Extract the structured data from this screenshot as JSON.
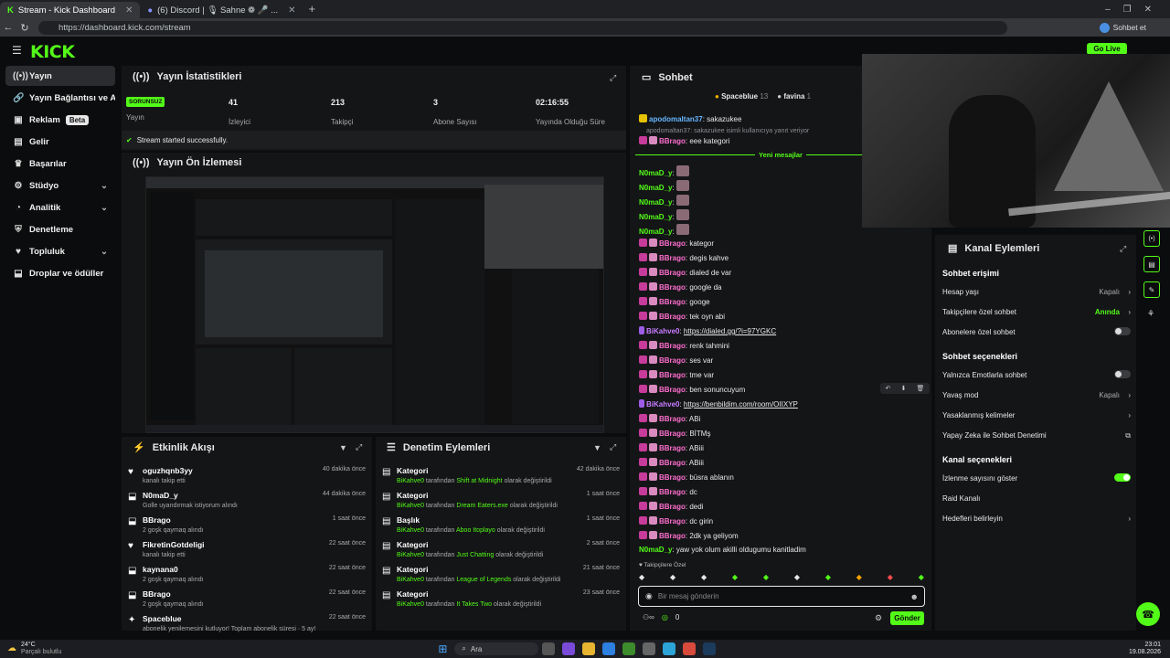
{
  "browser": {
    "tabs": [
      {
        "title": "Stream - Kick Dashboard"
      },
      {
        "title": "(6) Discord | 🎙 Sahne ❁ 🎤 ..."
      }
    ],
    "url": "https://dashboard.kick.com/stream",
    "profile_label": "Sohbet et"
  },
  "kick": {
    "logo": "KICK",
    "golive": "Go Live"
  },
  "sidebar": {
    "items": [
      {
        "label": "Yayın",
        "icon": "broadcast-icon"
      },
      {
        "label": "Yayın Bağlantısı ve Anahtarı",
        "icon": "link-icon"
      },
      {
        "label": "Reklam",
        "badge": "Beta",
        "icon": "ad-icon"
      },
      {
        "label": "Gelir",
        "icon": "money-icon"
      },
      {
        "label": "Başarılar",
        "icon": "trophy-icon"
      },
      {
        "label": "Stüdyo",
        "icon": "studio-icon"
      },
      {
        "label": "Analitik",
        "icon": "analytics-icon"
      },
      {
        "label": "Denetleme",
        "icon": "shield-icon"
      },
      {
        "label": "Topluluk",
        "icon": "community-icon"
      },
      {
        "label": "Droplar ve ödüller",
        "icon": "gift-icon"
      }
    ]
  },
  "stats": {
    "title": "Yayın İstatistikleri",
    "status_badge": "SORUNSUZ",
    "items": [
      {
        "value": "",
        "label": "Yayın"
      },
      {
        "value": "41",
        "label": "İzleyici"
      },
      {
        "value": "213",
        "label": "Takipçi"
      },
      {
        "value": "3",
        "label": "Abone Sayısı"
      },
      {
        "value": "02:16:55",
        "label": "Yayında Olduğu Süre"
      }
    ],
    "success": "Stream started successfully."
  },
  "preview": {
    "title": "Yayın Ön İzlemesi"
  },
  "activity": {
    "title": "Etkinlik Akışı",
    "items": [
      {
        "user": "oguzhqnb3yy",
        "desc": "kanalı takip etti",
        "time": "40 dakika önce",
        "icon": "heart-icon"
      },
      {
        "user": "N0maD_y",
        "desc": "Golle uyandırmak istiyorum alındı",
        "time": "44 dakika önce",
        "icon": "gift-icon"
      },
      {
        "user": "BBrago",
        "desc": "2 goşk qaymaq alındı",
        "time": "1 saat önce",
        "icon": "gift-icon"
      },
      {
        "user": "FikretinGotdeligi",
        "desc": "kanalı takip etti",
        "time": "22 saat önce",
        "icon": "heart-icon"
      },
      {
        "user": "kaynana0",
        "desc": "2 goşk qaymaq alındı",
        "time": "22 saat önce",
        "icon": "gift-icon"
      },
      {
        "user": "BBrago",
        "desc": "2 goşk qaymaq alındı",
        "time": "22 saat önce",
        "icon": "gift-icon"
      },
      {
        "user": "Spaceblue",
        "desc": "abonelik yenilemesini kutluyor! Toplam abonelik süresi · 5 ay!",
        "time": "22 saat önce",
        "icon": "star-icon"
      }
    ]
  },
  "moderation": {
    "title": "Denetim Eylemleri",
    "items": [
      {
        "type": "Kategori",
        "actor": "BiKahve0",
        "mid": " tarafından ",
        "val": "Shift at Midnight",
        "end": " olarak değiştirildi",
        "time": "42 dakika önce"
      },
      {
        "type": "Kategori",
        "actor": "BiKahve0",
        "mid": " tarafından ",
        "val": "Dream Eaters.exe",
        "end": " olarak değiştirildi",
        "time": "1 saat önce"
      },
      {
        "type": "Başlık",
        "actor": "BiKahve0",
        "mid": " tarafından ",
        "val": "Aboo Itoplayo",
        "end": " olarak değiştirildi",
        "time": "1 saat önce"
      },
      {
        "type": "Kategori",
        "actor": "BiKahve0",
        "mid": " tarafından ",
        "val": "Just Chatting",
        "end": " olarak değiştirildi",
        "time": "2 saat önce"
      },
      {
        "type": "Kategori",
        "actor": "BiKahve0",
        "mid": " tarafından ",
        "val": "League of Legends",
        "end": " olarak değiştirildi",
        "time": "21 saat önce"
      },
      {
        "type": "Kategori",
        "actor": "BiKahve0",
        "mid": " tarafından ",
        "val": "It Takes Two",
        "end": " olarak değiştirildi",
        "time": "23 saat önce"
      }
    ]
  },
  "chat": {
    "title": "Sohbet",
    "top_users": [
      {
        "name": "Spaceblue",
        "count": "13"
      },
      {
        "name": "favina",
        "count": "1"
      }
    ],
    "reply_note": "apodomaltan37: sakazukee isimli kullanıcıya yanıt veriyor",
    "new_messages": "Yeni mesajlar",
    "messages": [
      {
        "user": "apodomaltan37",
        "text": "sakazukee",
        "color": "bl"
      },
      {
        "user": "BBrago",
        "text": "eee kategori",
        "color": "pk"
      },
      {
        "user": "N0maD_y",
        "text": "",
        "color": "gr"
      },
      {
        "user": "N0maD_y",
        "text": "",
        "color": "gr"
      },
      {
        "user": "N0maD_y",
        "text": "",
        "color": "gr"
      },
      {
        "user": "N0maD_y",
        "text": "",
        "color": "gr"
      },
      {
        "user": "N0maD_y",
        "text": "",
        "color": "gr"
      },
      {
        "user": "BBrago",
        "text": "kategor",
        "color": "pk"
      },
      {
        "user": "BBrago",
        "text": "degis kahve",
        "color": "pk"
      },
      {
        "user": "BBrago",
        "text": "dialed de var",
        "color": "pk"
      },
      {
        "user": "BBrago",
        "text": "google da",
        "color": "pk"
      },
      {
        "user": "BBrago",
        "text": "googe",
        "color": "pk"
      },
      {
        "user": "BBrago",
        "text": "tek oyn abi",
        "color": "pk"
      },
      {
        "user": "BiKahve0",
        "text": "https://dialed.gg/?i=97YGKC",
        "color": "pu"
      },
      {
        "user": "BBrago",
        "text": "renk tahmini",
        "color": "pk"
      },
      {
        "user": "BBrago",
        "text": "ses var",
        "color": "pk"
      },
      {
        "user": "BBrago",
        "text": "tme var",
        "color": "pk"
      },
      {
        "user": "BBrago",
        "text": "ben sonuncuyum",
        "color": "pk"
      },
      {
        "user": "BiKahve0",
        "text": "https://benbildim.com/room/OIIXYP",
        "color": "pu"
      },
      {
        "user": "BBrago",
        "text": "ABi",
        "color": "pk"
      },
      {
        "user": "BBrago",
        "text": "BİTMş",
        "color": "pk"
      },
      {
        "user": "BBrago",
        "text": "ABiii",
        "color": "pk"
      },
      {
        "user": "BBrago",
        "text": "ABiii",
        "color": "pk"
      },
      {
        "user": "BBrago",
        "text": "büsra ablanın",
        "color": "pk"
      },
      {
        "user": "BBrago",
        "text": "dc",
        "color": "pk"
      },
      {
        "user": "BBrago",
        "text": "dedi",
        "color": "pk"
      },
      {
        "user": "BBrago",
        "text": "dc girin",
        "color": "pk"
      },
      {
        "user": "BBrago",
        "text": "2dk ya geliyom",
        "color": "pk"
      },
      {
        "user": "N0maD_y",
        "text": "yaw yok olum akilli oldugumu kanitladim",
        "color": "gr"
      }
    ],
    "followers_only": "♥ Takipçilere Özel",
    "placeholder": "Bir mesaj gönderin",
    "count": "0",
    "send": "Gönder"
  },
  "kanal": {
    "title": "Kanal Eylemleri",
    "sections": [
      {
        "header": "Sohbet erişimi",
        "rows": [
          {
            "label": "Hesap yaşı",
            "value": "Kapalı",
            "kind": "arrow"
          },
          {
            "label": "Takipçilere özel sohbet",
            "value": "Anında",
            "kind": "arrow",
            "green": true
          },
          {
            "label": "Abonelere özel sohbet",
            "value": "",
            "kind": "toggle",
            "on": false
          }
        ]
      },
      {
        "header": "Sohbet seçenekleri",
        "rows": [
          {
            "label": "Yalnızca Emotlarla sohbet",
            "value": "",
            "kind": "toggle",
            "on": false
          },
          {
            "label": "Yavaş mod",
            "value": "Kapalı",
            "kind": "arrow"
          },
          {
            "label": "Yasaklanmış kelimeler",
            "value": "",
            "kind": "arrow"
          },
          {
            "label": "Yapay Zeka ile Sohbet Denetimi",
            "value": "",
            "kind": "ext"
          }
        ]
      },
      {
        "header": "Kanal seçenekleri",
        "rows": [
          {
            "label": "İzlenme sayısını göster",
            "value": "",
            "kind": "toggle",
            "on": true
          },
          {
            "label": "Raid Kanalı",
            "value": "",
            "kind": "none"
          },
          {
            "label": "Hedefleri belirleyin",
            "value": "",
            "kind": "arrow"
          }
        ]
      }
    ]
  },
  "taskbar": {
    "weather_temp": "24°C",
    "weather_desc": "Parçalı bulutlu",
    "search": "Ara",
    "time": "23:01",
    "date": "19.08.2026"
  },
  "colors": {
    "accent": "#53fc18",
    "bg": "#0b0c0d",
    "panel": "#141517"
  }
}
